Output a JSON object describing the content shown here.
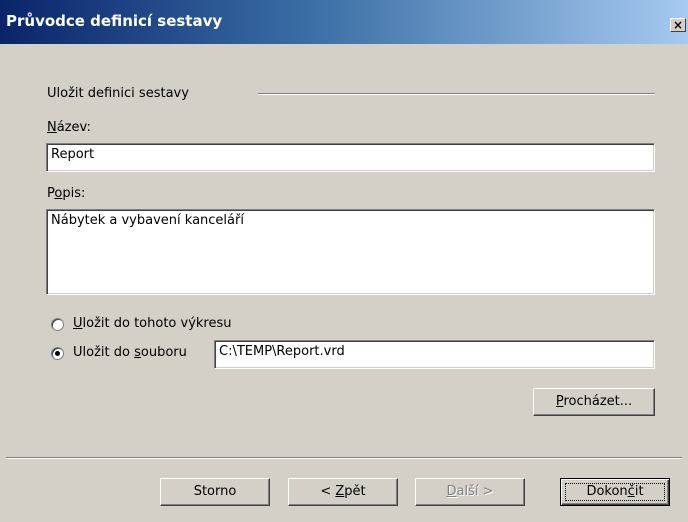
{
  "window": {
    "title": "Průvodce definicí sestavy",
    "close_label": "×"
  },
  "section": {
    "heading": "Uložit definici sestavy"
  },
  "name_field": {
    "label_prefix": "",
    "label_accel": "N",
    "label_rest": "ázev:",
    "value": "Report"
  },
  "description_field": {
    "label_prefix": "P",
    "label_accel": "o",
    "label_rest": "pis:",
    "value": "Nábytek a vybavení kanceláří"
  },
  "save_options": {
    "option_drawing": {
      "label_prefix": "",
      "label_accel": "U",
      "label_rest": "ložit do tohoto výkresu",
      "selected": false
    },
    "option_file": {
      "label_prefix": "Uložit do ",
      "label_accel": "s",
      "label_rest": "ouboru",
      "selected": true
    },
    "file_path": "C:\\TEMP\\Report.vrd"
  },
  "buttons": {
    "browse": {
      "prefix": "",
      "accel": "P",
      "rest": "rocházet..."
    },
    "cancel": {
      "label": "Storno"
    },
    "back": {
      "prefix": "< ",
      "accel": "Z",
      "rest": "pět"
    },
    "next": {
      "prefix": "",
      "accel": "D",
      "rest": "alší >",
      "enabled": false
    },
    "finish": {
      "prefix": "Dokon",
      "accel": "č",
      "rest": "it"
    }
  }
}
